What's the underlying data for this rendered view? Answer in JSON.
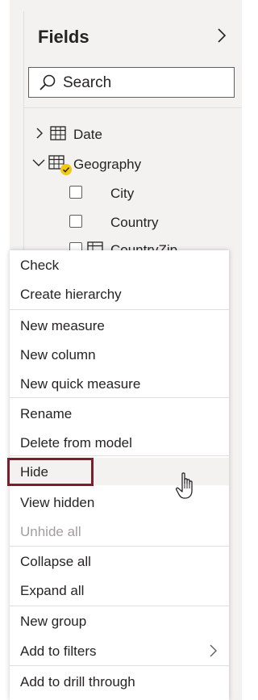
{
  "pane": {
    "title": "Fields",
    "search_placeholder": "Search"
  },
  "tree": {
    "tables": [
      {
        "label": "Date",
        "expanded": false
      },
      {
        "label": "Geography",
        "expanded": true
      }
    ],
    "geography_fields": [
      {
        "label": "City",
        "checked": false
      },
      {
        "label": "Country",
        "checked": false
      },
      {
        "label": "CountryZip",
        "checked": false
      }
    ]
  },
  "menu": {
    "items": [
      {
        "label": "Check",
        "enabled": true
      },
      {
        "label": "Create hierarchy",
        "enabled": true
      },
      {
        "label": "New measure",
        "enabled": true
      },
      {
        "label": "New column",
        "enabled": true
      },
      {
        "label": "New quick measure",
        "enabled": true
      },
      {
        "label": "Rename",
        "enabled": true
      },
      {
        "label": "Delete from model",
        "enabled": true
      },
      {
        "label": "Hide",
        "enabled": true,
        "highlighted": true
      },
      {
        "label": "View hidden",
        "enabled": true
      },
      {
        "label": "Unhide all",
        "enabled": false
      },
      {
        "label": "Collapse all",
        "enabled": true
      },
      {
        "label": "Expand all",
        "enabled": true
      },
      {
        "label": "New group",
        "enabled": true
      },
      {
        "label": "Add to filters",
        "enabled": true,
        "has_submenu": true
      },
      {
        "label": "Add to drill through",
        "enabled": true
      }
    ]
  },
  "colors": {
    "highlight_border": "#7a1f2c",
    "badge": "#f2c811",
    "pane_bg": "#f3f2f1"
  },
  "icons": {
    "collapse": "chevron-right-icon",
    "search": "search-icon",
    "table": "table-icon",
    "cursor": "hand-pointer-icon"
  }
}
